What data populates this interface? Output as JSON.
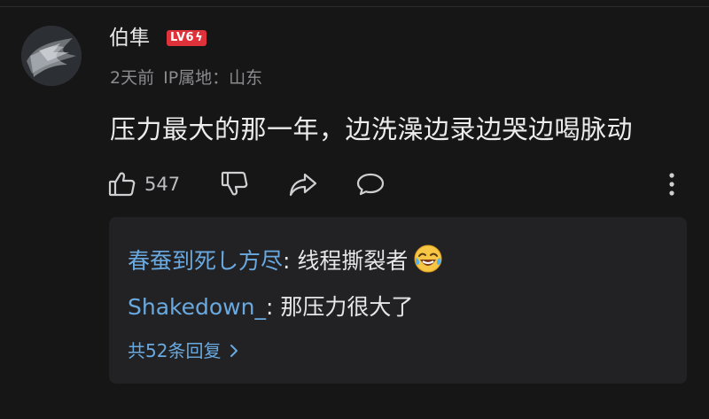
{
  "comment": {
    "username": "伯隼",
    "level": "LV6",
    "time": "2天前",
    "ip_location": "IP属地：山东",
    "text": "压力最大的那一年，边洗澡边录边哭边喝脉动",
    "likes": "547"
  },
  "replies": [
    {
      "author": "春蚕到死し方尽",
      "separator": ": ",
      "text": "线程撕裂者",
      "emoji": "laughing-crying-emoji"
    },
    {
      "author": "Shakedown_",
      "separator": ": ",
      "text": "那压力很大了"
    }
  ],
  "more_replies_label": "共52条回复",
  "colors": {
    "background": "#161617",
    "reply_box": "#222224",
    "link_blue": "#6aa9df",
    "badge_red": "#e0323a"
  }
}
